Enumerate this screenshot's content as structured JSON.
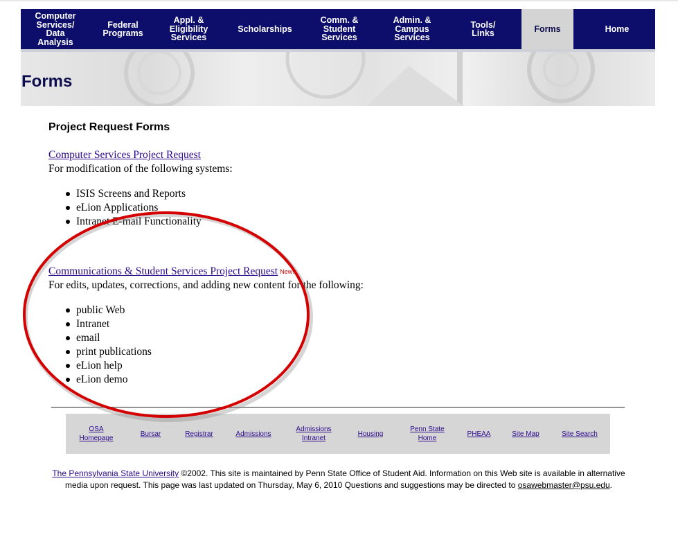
{
  "nav": {
    "items": [
      {
        "label": "Computer\nServices/\nData\nAnalysis"
      },
      {
        "label": "Federal\nPrograms"
      },
      {
        "label": "Appl. &\nEligibility\nServices"
      },
      {
        "label": "Scholarships"
      },
      {
        "label": "Comm. &\nStudent\nServices"
      },
      {
        "label": "Admin. &\nCampus\nServices"
      },
      {
        "label": "Tools/\nLinks"
      },
      {
        "label": "Forms"
      },
      {
        "label": "Home"
      }
    ]
  },
  "page": {
    "title": "Forms"
  },
  "content": {
    "heading": "Project Request Forms",
    "cs_link": "Computer Services Project Request",
    "cs_desc": "For modification of the following systems:",
    "cs_items": [
      "ISIS Screens and Reports",
      "eLion Applications",
      "Intranet E-mail Functionality"
    ],
    "comm_link": "Communications & Student Services Project Request",
    "comm_new": "New!",
    "comm_desc": "For edits, updates, corrections, and adding new content for the following:",
    "comm_items": [
      "public Web",
      "Intranet",
      "email",
      "print publications",
      "eLion help",
      "eLion demo"
    ]
  },
  "footer_nav": {
    "items": [
      {
        "label": "OSA\nHomepage"
      },
      {
        "label": "Bursar"
      },
      {
        "label": "Registrar"
      },
      {
        "label": "Admissions"
      },
      {
        "label": "Admissions\nIntranet"
      },
      {
        "label": "Housing"
      },
      {
        "label": "Penn State\nHome"
      },
      {
        "label": "PHEAA"
      },
      {
        "label": "Site Map"
      },
      {
        "label": "Site Search"
      }
    ]
  },
  "footer": {
    "university_link": "The Pennsylvania State University",
    "text": " ©2002. This site is maintained by Penn State Office of Student Aid. Information on this Web site is available in alternative media upon request. This page was last updated on Thursday, May 6, 2010 Questions and suggestions may be directed to ",
    "email": "osawebmaster@psu.edu",
    "end": "."
  },
  "colors": {
    "nav_bg": "#0d0d6b",
    "nav_active_bg": "#d4d4d4",
    "link": "#2c0a8c",
    "annotation_ellipse": "#d40000"
  }
}
